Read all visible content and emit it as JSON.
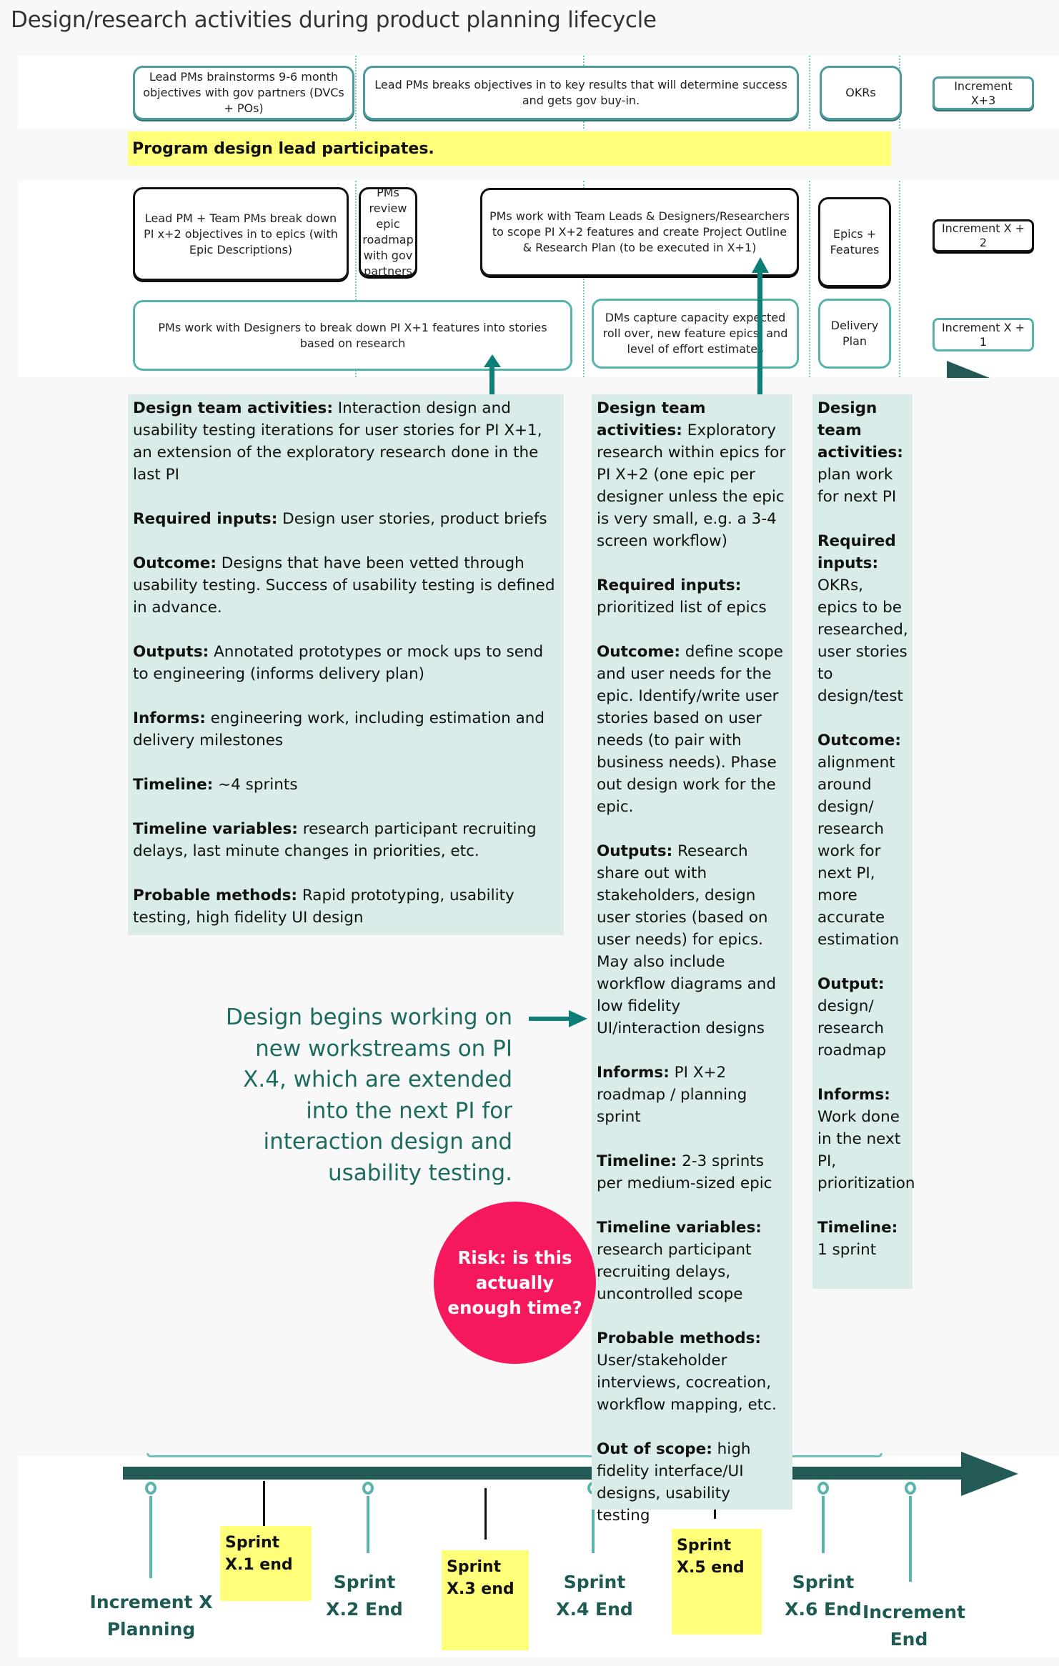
{
  "title": "Design/research activities during product planning lifecycle",
  "rows": {
    "increment_x3": {
      "boxes": [
        {
          "text": "Lead PMs brainstorms 9-6 month objectives with gov partners (DVCs + POs)"
        },
        {
          "text": "Lead PMs breaks objectives in to key results that will determine success and gets gov buy-in."
        },
        {
          "text": "OKRs"
        }
      ],
      "increment_label": "Increment X+3"
    },
    "design_lead_note": "Program design lead participates.",
    "increment_x2": {
      "boxes": [
        {
          "text": "Lead PM + Team PMs break down PI x+2 objectives in to epics (with Epic Descriptions)"
        },
        {
          "text": "PMs review epic roadmap with gov partners"
        },
        {
          "text": "PMs work with Team Leads & Designers/Researchers to scope PI X+2 features and create Project Outline & Research Plan (to be executed in X+1)"
        },
        {
          "text": "Epics + Features"
        }
      ],
      "increment_label": "Increment X + 2"
    },
    "increment_x1": {
      "boxes": [
        {
          "text": "PMs work with Designers to break down PI X+1 features into stories based on research"
        },
        {
          "text": "DMs capture capacity expected roll over, new feature epics, and level of effort estimates"
        },
        {
          "text": "Delivery Plan"
        }
      ],
      "increment_label": "Increment X + 1"
    }
  },
  "panels": {
    "left": [
      {
        "label": "Design team activities:",
        "text": " Interaction design and usability testing iterations for user stories for PI X+1, an extension of the exploratory research done in the last PI"
      },
      {
        "label": "Required inputs:",
        "text": " Design user stories, product briefs"
      },
      {
        "label": "Outcome:",
        "text": " Designs that have been vetted through usability testing. Success of usability testing is defined in advance."
      },
      {
        "label": "Outputs:",
        "text": " Annotated prototypes or mock ups to send to engineering  (informs delivery plan)"
      },
      {
        "label": "Informs:",
        "text": " engineering work, including estimation and delivery milestones"
      },
      {
        "label": "Timeline:",
        "text": " ~4 sprints"
      },
      {
        "label": "Timeline variables:",
        "text": " research participant recruiting delays, last minute changes in priorities, etc."
      },
      {
        "label": "Probable methods:",
        "text": " Rapid prototyping, usability testing, high fidelity UI design"
      }
    ],
    "middle": [
      {
        "label": "Design team activities:",
        "text": " Exploratory research within epics for PI X+2 (one epic per designer unless the epic is very small, e.g. a 3-4 screen workflow)"
      },
      {
        "label": "Required inputs:",
        "text": " prioritized list of epics"
      },
      {
        "label": "Outcome:",
        "text": " define scope and user needs for the epic. Identify/write user stories based on user needs (to pair with business needs). Phase out design work for the epic."
      },
      {
        "label": "Outputs:",
        "text": " Research share out with stakeholders, design user stories (based on user needs) for epics. May also include workflow diagrams and low fidelity UI/interaction designs"
      },
      {
        "label": "Informs:",
        "text": " PI X+2 roadmap / planning sprint"
      },
      {
        "label": "Timeline:",
        "text": " 2-3 sprints per medium-sized epic"
      },
      {
        "label": "Timeline variables:",
        "text": " research participant recruiting delays, uncontrolled scope"
      },
      {
        "label": "Probable methods:",
        "text": " User/stakeholder interviews, cocreation, workflow mapping, etc."
      },
      {
        "label": "Out of scope:",
        "text": " high fidelity interface/UI designs, usability testing"
      }
    ],
    "right": [
      {
        "label": "Design team activities:",
        "text": " plan work for next PI"
      },
      {
        "label": "Required inputs:",
        "text": " OKRs, epics to be researched, user stories to design/test"
      },
      {
        "label": "Outcome:",
        "text": " alignment around design/ research work for next PI, more accurate estimation"
      },
      {
        "label": "Output:",
        "text": " design/ research roadmap"
      },
      {
        "label": "Informs:",
        "text": " Work done in the next PI, prioritization"
      },
      {
        "label": "Timeline:",
        "text": " 1 sprint"
      }
    ]
  },
  "callout": "Design begins working on new workstreams on PI X.4, which are extended into the next PI for interaction design and usability testing.",
  "risk": "Risk: is this actually enough time?",
  "timeline": {
    "milestones": [
      {
        "label": "Increment X Planning"
      },
      {
        "label": "Sprint X.2 End"
      },
      {
        "label": "Sprint X.4 End"
      },
      {
        "label": "Sprint X.6 End"
      },
      {
        "label": "Increment End"
      }
    ],
    "sprint_notes": [
      {
        "label": "Sprint X.1 end"
      },
      {
        "label": "Sprint X.3 end"
      },
      {
        "label": "Sprint X.5 end"
      }
    ]
  },
  "colors": {
    "teal_border": "#4a9b9b",
    "panel_bg": "#d9ecea",
    "highlight_yellow": "#ffff7a",
    "risk_pink": "#f5185c",
    "timeline_dark": "#235a55",
    "arrow_teal": "#0e7f76",
    "callout_text": "#1d6b60"
  }
}
